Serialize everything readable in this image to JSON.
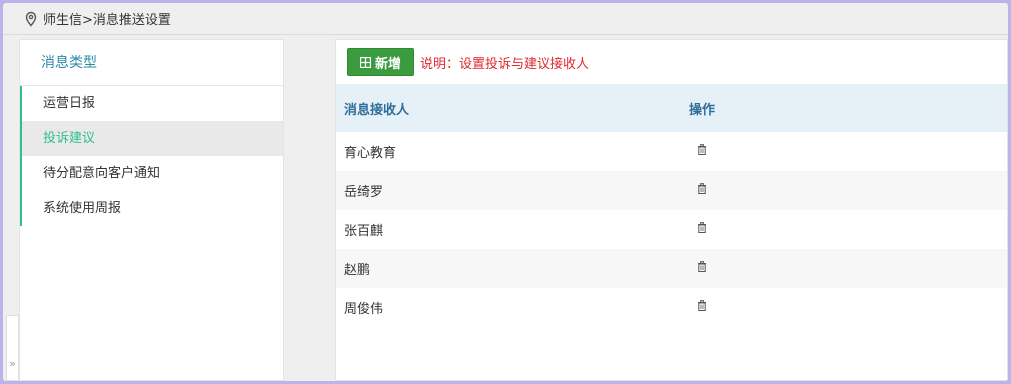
{
  "breadcrumb": {
    "text": "师生信>消息推送设置"
  },
  "left_panel": {
    "title": "消息类型",
    "items": [
      {
        "label": "运营日报",
        "active": false
      },
      {
        "label": "投诉建议",
        "active": true
      },
      {
        "label": "待分配意向客户通知",
        "active": false
      },
      {
        "label": "系统使用周报",
        "active": false
      }
    ]
  },
  "collapse": {
    "glyph": "»"
  },
  "toolbar": {
    "add_label": "新增",
    "note": "说明：设置投诉与建议接收人"
  },
  "table": {
    "headers": {
      "receiver": "消息接收人",
      "op": "操作"
    },
    "rows": [
      {
        "receiver": "育心教育"
      },
      {
        "receiver": "岳绮罗"
      },
      {
        "receiver": "张百麒"
      },
      {
        "receiver": "赵鹏"
      },
      {
        "receiver": "周俊伟"
      }
    ]
  },
  "colors": {
    "accent_green": "#2ebf91",
    "button_green": "#3b9b3f",
    "title_blue": "#2a8ba8",
    "header_bg": "#e6f1f7",
    "note_red": "#e0282f"
  }
}
